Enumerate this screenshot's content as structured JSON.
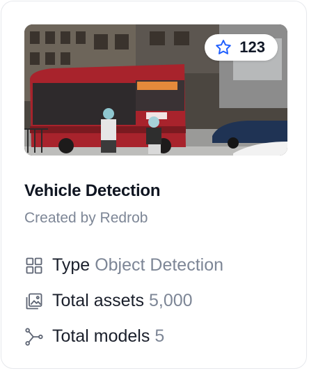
{
  "card": {
    "star_count": "123",
    "title": "Vehicle Detection",
    "creator": "Created by Redrob",
    "thumbnail_icon": "street-scene-image",
    "meta": {
      "type": {
        "label": "Type",
        "value": "Object Detection",
        "icon": "grid-icon"
      },
      "assets": {
        "label": "Total assets",
        "value": "5,000",
        "icon": "image-gallery-icon"
      },
      "models": {
        "label": "Total models",
        "value": "5",
        "icon": "branch-icon"
      }
    }
  },
  "colors": {
    "star_outline": "#1e5eff",
    "title": "#0f1521",
    "muted": "#7d8696"
  }
}
